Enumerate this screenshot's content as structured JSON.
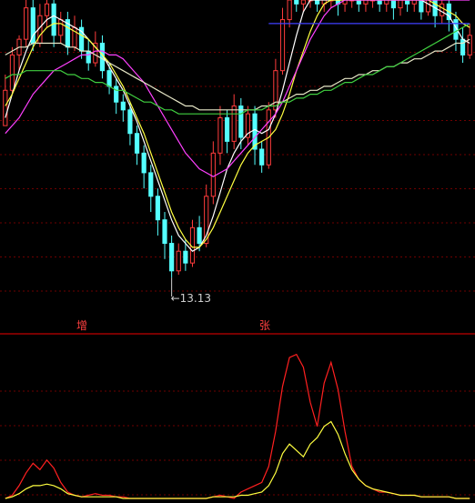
{
  "colors": {
    "background": "#000000",
    "grid": "#6e0000",
    "divider": "#c00000",
    "candle_up": "#ff3c3c",
    "candle_down": "#54ffff",
    "low_annotation": "#cfcfcf",
    "panel_label": "#ff4040"
  },
  "chart_data": [
    {
      "type": "candlestick",
      "panel": "price",
      "min_price_label": "←13.13",
      "min_price": 13.13,
      "ylim": [
        12.6,
        20.2
      ],
      "candles": [
        [
          17.0,
          17.9,
          17.0,
          18.3
        ],
        [
          17.9,
          18.8,
          17.8,
          19.0
        ],
        [
          18.8,
          19.2,
          18.4,
          19.3
        ],
        [
          19.2,
          20.0,
          19.0,
          20.2
        ],
        [
          20.0,
          19.1,
          18.9,
          20.2
        ],
        [
          19.1,
          19.8,
          19.0,
          20.1
        ],
        [
          19.8,
          20.1,
          19.5,
          20.2
        ],
        [
          20.1,
          19.3,
          19.0,
          20.2
        ],
        [
          19.3,
          19.7,
          19.1,
          19.9
        ],
        [
          19.7,
          19.0,
          18.8,
          19.9
        ],
        [
          19.0,
          19.5,
          18.9,
          19.8
        ],
        [
          19.5,
          18.9,
          18.7,
          19.7
        ],
        [
          18.9,
          18.6,
          18.4,
          19.2
        ],
        [
          18.6,
          19.1,
          18.5,
          19.4
        ],
        [
          19.1,
          18.4,
          18.2,
          19.3
        ],
        [
          18.4,
          18.0,
          17.8,
          18.6
        ],
        [
          18.0,
          17.6,
          17.3,
          18.2
        ],
        [
          17.6,
          17.4,
          17.1,
          17.8
        ],
        [
          17.4,
          16.8,
          16.5,
          17.6
        ],
        [
          16.8,
          16.3,
          16.0,
          17.0
        ],
        [
          16.3,
          15.8,
          15.4,
          16.5
        ],
        [
          15.8,
          15.2,
          14.8,
          16.0
        ],
        [
          15.2,
          14.6,
          14.2,
          15.4
        ],
        [
          14.6,
          14.0,
          13.6,
          14.8
        ],
        [
          14.0,
          13.3,
          13.13,
          14.2
        ],
        [
          13.3,
          13.8,
          13.2,
          14.0
        ],
        [
          13.8,
          13.5,
          13.3,
          14.1
        ],
        [
          13.5,
          14.4,
          13.4,
          14.6
        ],
        [
          14.4,
          14.0,
          13.8,
          14.7
        ],
        [
          14.0,
          15.2,
          13.9,
          15.5
        ],
        [
          15.2,
          16.3,
          15.0,
          16.6
        ],
        [
          16.3,
          17.2,
          16.0,
          17.5
        ],
        [
          17.2,
          16.6,
          16.3,
          17.4
        ],
        [
          16.6,
          17.5,
          16.4,
          17.8
        ],
        [
          17.5,
          16.7,
          16.4,
          17.7
        ],
        [
          16.7,
          17.3,
          16.5,
          17.5
        ],
        [
          17.3,
          16.4,
          16.0,
          17.5
        ],
        [
          16.4,
          16.0,
          15.8,
          16.6
        ],
        [
          16.0,
          17.4,
          15.9,
          17.6
        ],
        [
          17.4,
          18.4,
          17.2,
          18.7
        ],
        [
          18.4,
          19.7,
          18.3,
          20.0
        ],
        [
          19.7,
          20.2,
          19.5,
          20.2
        ],
        [
          20.2,
          20.1,
          19.9,
          20.2
        ],
        [
          20.1,
          20.2,
          19.9,
          20.2
        ],
        [
          20.2,
          20.2,
          20.0,
          20.2
        ],
        [
          20.2,
          20.1,
          19.9,
          20.2
        ],
        [
          20.1,
          20.2,
          19.9,
          20.2
        ],
        [
          20.2,
          20.2,
          20.0,
          20.2
        ],
        [
          20.2,
          20.1,
          19.8,
          20.2
        ],
        [
          20.1,
          20.2,
          19.9,
          20.2
        ],
        [
          20.2,
          20.2,
          20.0,
          20.2
        ],
        [
          20.2,
          20.1,
          19.9,
          20.2
        ],
        [
          20.1,
          20.2,
          19.9,
          20.2
        ],
        [
          20.2,
          20.2,
          20.0,
          20.2
        ],
        [
          20.2,
          20.1,
          19.9,
          20.2
        ],
        [
          20.1,
          20.2,
          19.9,
          20.2
        ],
        [
          20.2,
          20.0,
          19.7,
          20.2
        ],
        [
          20.0,
          20.2,
          19.8,
          20.2
        ],
        [
          20.2,
          20.1,
          19.9,
          20.2
        ],
        [
          20.1,
          20.2,
          19.9,
          20.2
        ],
        [
          20.2,
          19.9,
          19.7,
          20.2
        ],
        [
          19.9,
          20.2,
          19.8,
          20.2
        ],
        [
          20.2,
          19.8,
          19.5,
          20.2
        ],
        [
          19.8,
          20.1,
          19.6,
          20.2
        ],
        [
          20.1,
          19.7,
          19.4,
          20.2
        ],
        [
          19.7,
          19.2,
          18.9,
          19.9
        ],
        [
          19.2,
          18.8,
          18.6,
          19.5
        ],
        [
          18.8,
          19.3,
          18.7,
          19.6
        ]
      ],
      "series": [
        {
          "color": "#ffffff",
          "values": [
            17.2,
            17.8,
            18.4,
            18.9,
            19.3,
            19.5,
            19.7,
            19.8,
            19.7,
            19.6,
            19.5,
            19.4,
            19.2,
            19.0,
            18.8,
            18.5,
            18.2,
            17.9,
            17.5,
            17.1,
            16.6,
            16.1,
            15.6,
            15.1,
            14.6,
            14.2,
            14.0,
            13.8,
            13.9,
            14.2,
            14.7,
            15.3,
            15.9,
            16.3,
            16.6,
            16.8,
            16.9,
            16.8,
            16.9,
            17.3,
            17.9,
            18.6,
            19.3,
            19.9,
            20.2,
            20.2,
            20.2,
            20.2,
            20.2,
            20.2,
            20.2,
            20.2,
            20.2,
            20.2,
            20.2,
            20.2,
            20.2,
            20.2,
            20.2,
            20.2,
            20.2,
            20.1,
            20.0,
            19.9,
            19.8,
            19.5,
            19.2,
            19.1
          ]
        },
        {
          "color": "#ffff40",
          "values": [
            17.5,
            17.8,
            18.2,
            18.6,
            19.0,
            19.3,
            19.5,
            19.6,
            19.6,
            19.5,
            19.4,
            19.3,
            19.2,
            19.0,
            18.8,
            18.6,
            18.3,
            18.0,
            17.6,
            17.2,
            16.8,
            16.3,
            15.8,
            15.3,
            14.8,
            14.4,
            14.1,
            13.9,
            13.9,
            14.1,
            14.4,
            14.8,
            15.2,
            15.6,
            16.0,
            16.3,
            16.5,
            16.6,
            16.7,
            16.9,
            17.3,
            17.8,
            18.4,
            18.9,
            19.4,
            19.8,
            20.1,
            20.2,
            20.2,
            20.2,
            20.2,
            20.2,
            20.2,
            20.2,
            20.2,
            20.2,
            20.2,
            20.2,
            20.2,
            20.2,
            20.2,
            20.2,
            20.1,
            20.0,
            19.9,
            19.8,
            19.6,
            19.5
          ]
        },
        {
          "color": "#ff40ff",
          "values": [
            16.8,
            17.0,
            17.2,
            17.5,
            17.8,
            18.0,
            18.2,
            18.4,
            18.5,
            18.6,
            18.7,
            18.8,
            18.8,
            18.9,
            18.9,
            18.8,
            18.8,
            18.7,
            18.5,
            18.3,
            18.1,
            17.8,
            17.5,
            17.2,
            16.9,
            16.6,
            16.3,
            16.1,
            15.9,
            15.8,
            15.7,
            15.8,
            15.9,
            16.1,
            16.3,
            16.5,
            16.7,
            16.9,
            17.1,
            17.3,
            17.6,
            18.0,
            18.4,
            18.8,
            19.2,
            19.5,
            19.8,
            20.0,
            20.1,
            20.2,
            20.2,
            20.2,
            20.2,
            20.2,
            20.2,
            20.2,
            20.2,
            20.2,
            20.2,
            20.2,
            20.2,
            20.2,
            20.2,
            20.2,
            20.2,
            20.2,
            20.2,
            20.2
          ]
        },
        {
          "color": "#e8e8c8",
          "values": [
            18.8,
            18.9,
            19.0,
            19.0,
            19.1,
            19.1,
            19.1,
            19.1,
            19.1,
            19.0,
            19.0,
            18.9,
            18.9,
            18.8,
            18.7,
            18.6,
            18.5,
            18.4,
            18.3,
            18.2,
            18.1,
            18.0,
            17.9,
            17.8,
            17.7,
            17.6,
            17.5,
            17.5,
            17.4,
            17.4,
            17.4,
            17.4,
            17.4,
            17.4,
            17.4,
            17.4,
            17.4,
            17.5,
            17.5,
            17.6,
            17.6,
            17.7,
            17.8,
            17.8,
            17.9,
            17.9,
            18.0,
            18.0,
            18.1,
            18.2,
            18.2,
            18.3,
            18.3,
            18.4,
            18.4,
            18.5,
            18.5,
            18.6,
            18.6,
            18.7,
            18.7,
            18.8,
            18.9,
            18.9,
            19.0,
            19.1,
            19.1,
            19.2
          ]
        },
        {
          "color": "#40d040",
          "values": [
            18.2,
            18.3,
            18.3,
            18.4,
            18.4,
            18.4,
            18.4,
            18.4,
            18.4,
            18.3,
            18.3,
            18.2,
            18.2,
            18.1,
            18.1,
            18.0,
            17.9,
            17.9,
            17.8,
            17.7,
            17.6,
            17.6,
            17.5,
            17.4,
            17.4,
            17.3,
            17.3,
            17.3,
            17.3,
            17.3,
            17.3,
            17.3,
            17.3,
            17.3,
            17.3,
            17.4,
            17.4,
            17.4,
            17.5,
            17.5,
            17.6,
            17.6,
            17.7,
            17.7,
            17.8,
            17.8,
            17.9,
            17.9,
            18.0,
            18.1,
            18.1,
            18.2,
            18.3,
            18.3,
            18.4,
            18.5,
            18.5,
            18.6,
            18.7,
            18.8,
            18.9,
            19.0,
            19.1,
            19.2,
            19.3,
            19.4,
            19.5,
            19.6
          ]
        },
        {
          "color": "#4040ff",
          "values": [
            null,
            null,
            null,
            null,
            null,
            null,
            null,
            null,
            null,
            null,
            null,
            null,
            null,
            null,
            null,
            null,
            null,
            null,
            null,
            null,
            null,
            null,
            null,
            null,
            null,
            null,
            null,
            null,
            null,
            null,
            null,
            null,
            null,
            null,
            null,
            null,
            null,
            null,
            19.6,
            19.6,
            19.6,
            19.6,
            19.6,
            19.6,
            19.6,
            19.6,
            19.6,
            19.6,
            19.6,
            19.6,
            19.6,
            19.6,
            19.6,
            19.6,
            19.6,
            19.6,
            19.6,
            19.6,
            19.6,
            19.6,
            19.6,
            19.6,
            19.6,
            19.6,
            19.6,
            19.6,
            19.6,
            19.6
          ]
        }
      ]
    },
    {
      "type": "line",
      "panel": "indicator",
      "labels": [
        "增",
        "张"
      ],
      "ylim": [
        0,
        100
      ],
      "series": [
        {
          "color": "#ff2020",
          "values": [
            0,
            2,
            8,
            16,
            22,
            18,
            24,
            19,
            10,
            4,
            2,
            1,
            2,
            3,
            2,
            2,
            1,
            1,
            0,
            0,
            0,
            0,
            0,
            0,
            0,
            0,
            0,
            0,
            0,
            0,
            1,
            2,
            1,
            0,
            4,
            6,
            8,
            10,
            20,
            42,
            70,
            88,
            90,
            82,
            60,
            45,
            72,
            85,
            68,
            42,
            20,
            12,
            8,
            6,
            4,
            4,
            3,
            2,
            2,
            2,
            1,
            1,
            1,
            1,
            1,
            0,
            0,
            0
          ]
        },
        {
          "color": "#ffff40",
          "values": [
            0,
            1,
            3,
            6,
            8,
            8,
            9,
            8,
            6,
            3,
            2,
            1,
            1,
            1,
            1,
            1,
            1,
            0,
            0,
            0,
            0,
            0,
            0,
            0,
            0,
            0,
            0,
            0,
            0,
            0,
            1,
            1,
            1,
            1,
            2,
            2,
            3,
            4,
            8,
            16,
            28,
            34,
            30,
            26,
            34,
            38,
            45,
            48,
            40,
            28,
            18,
            12,
            8,
            6,
            5,
            4,
            3,
            2,
            2,
            2,
            1,
            1,
            1,
            1,
            1,
            0,
            0,
            0
          ]
        }
      ]
    }
  ]
}
